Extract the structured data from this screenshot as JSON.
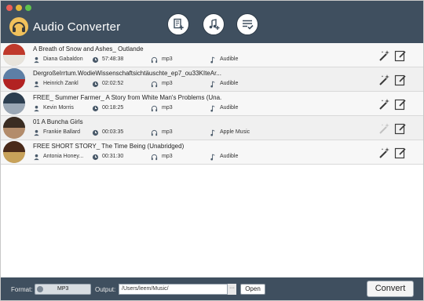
{
  "app": {
    "title": "Audio Converter"
  },
  "toolbar": {
    "buttons": [
      {
        "name": "add-files",
        "icon": "add-document-icon"
      },
      {
        "name": "add-music",
        "icon": "add-music-icon"
      },
      {
        "name": "converted-list",
        "icon": "checklist-icon"
      }
    ]
  },
  "tracks": [
    {
      "title": "A Breath of Snow and Ashes_ Outlande",
      "author": "Diana Gabaldon",
      "duration": "57:48:38",
      "format": "mp3",
      "source": "Audible",
      "edit_enabled": true,
      "cover_colors": [
        "#c0392b",
        "#e8e4dc"
      ]
    },
    {
      "title": "DergroßeIrrtum.WodieWissenschaftsichtäuschte_ep7_ou33KIteAr...",
      "author": "Heinrich Zankl",
      "duration": "02:02:52",
      "format": "mp3",
      "source": "Audible",
      "edit_enabled": true,
      "cover_colors": [
        "#5d7fa6",
        "#b22222"
      ]
    },
    {
      "title": "FREE_ Summer Farmer_ A Story from White Man's Problems (Una...",
      "author": "Kevin Morris",
      "duration": "00:18:25",
      "format": "mp3",
      "source": "Audible",
      "edit_enabled": true,
      "cover_colors": [
        "#2c3e50",
        "#9aa7b5"
      ]
    },
    {
      "title": "01 A Buncha Girls",
      "author": "Frankie Ballard",
      "duration": "00:03:35",
      "format": "mp3",
      "source": "Apple Music",
      "edit_enabled": false,
      "cover_colors": [
        "#3a2c22",
        "#b38c6b"
      ]
    },
    {
      "title": "FREE SHORT STORY_ The Time Being (Unabridged)",
      "author": "Antonia Honey...",
      "duration": "00:31:30",
      "format": "mp3",
      "source": "Audible",
      "edit_enabled": true,
      "cover_colors": [
        "#4a2a1a",
        "#c8a25a"
      ]
    }
  ],
  "bottom": {
    "format_label": "Format:",
    "format_value": "MP3",
    "output_label": "Output:",
    "output_path": "/Users/leem/Music/",
    "browse_label": "···",
    "open_label": "Open",
    "convert_label": "Convert"
  },
  "colors": {
    "toolbar_bg": "#3f4f5f",
    "logo": "#f1c15b"
  }
}
